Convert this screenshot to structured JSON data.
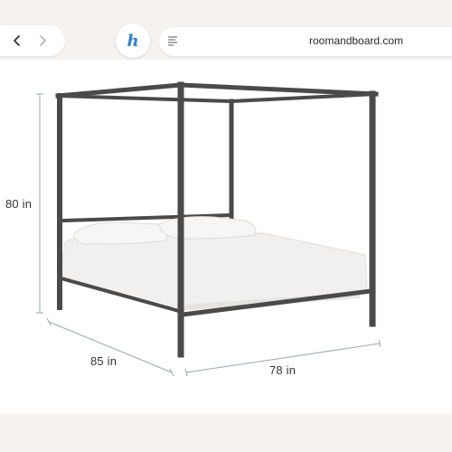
{
  "browser": {
    "url": "roomandboard.com",
    "back_icon": "chevron-left-icon",
    "forward_icon": "chevron-right-icon",
    "extension_icon": "honey-extension-icon",
    "reader_icon": "reader-mode-icon",
    "extension_letter": "h"
  },
  "product_image": {
    "dimensions": {
      "height": "80 in",
      "depth": "85 in",
      "width": "78 in"
    },
    "colors": {
      "frame": "#4a4a4a",
      "bedding": "#f1f0ee",
      "dimension_line": "#9aa7b3"
    }
  }
}
